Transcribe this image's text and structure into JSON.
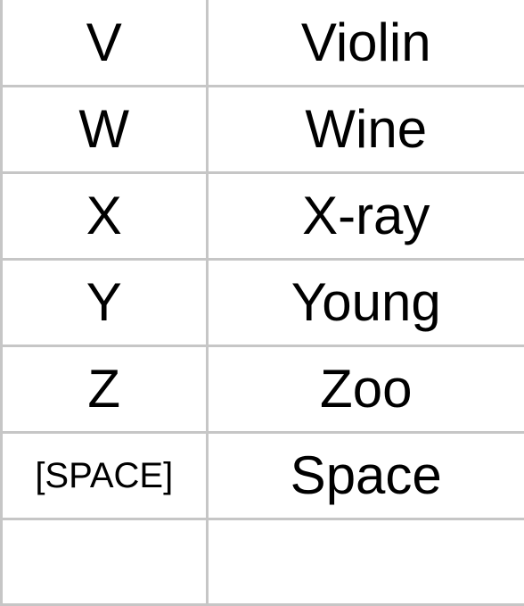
{
  "table": {
    "rows": [
      {
        "letter": "V",
        "word": "Violin"
      },
      {
        "letter": "W",
        "word": "Wine"
      },
      {
        "letter": "X",
        "word": "X-ray"
      },
      {
        "letter": "Y",
        "word": "Young"
      },
      {
        "letter": "Z",
        "word": "Zoo"
      },
      {
        "letter": "[SPACE]",
        "word": "Space"
      },
      {
        "letter": "",
        "word": ""
      }
    ]
  }
}
